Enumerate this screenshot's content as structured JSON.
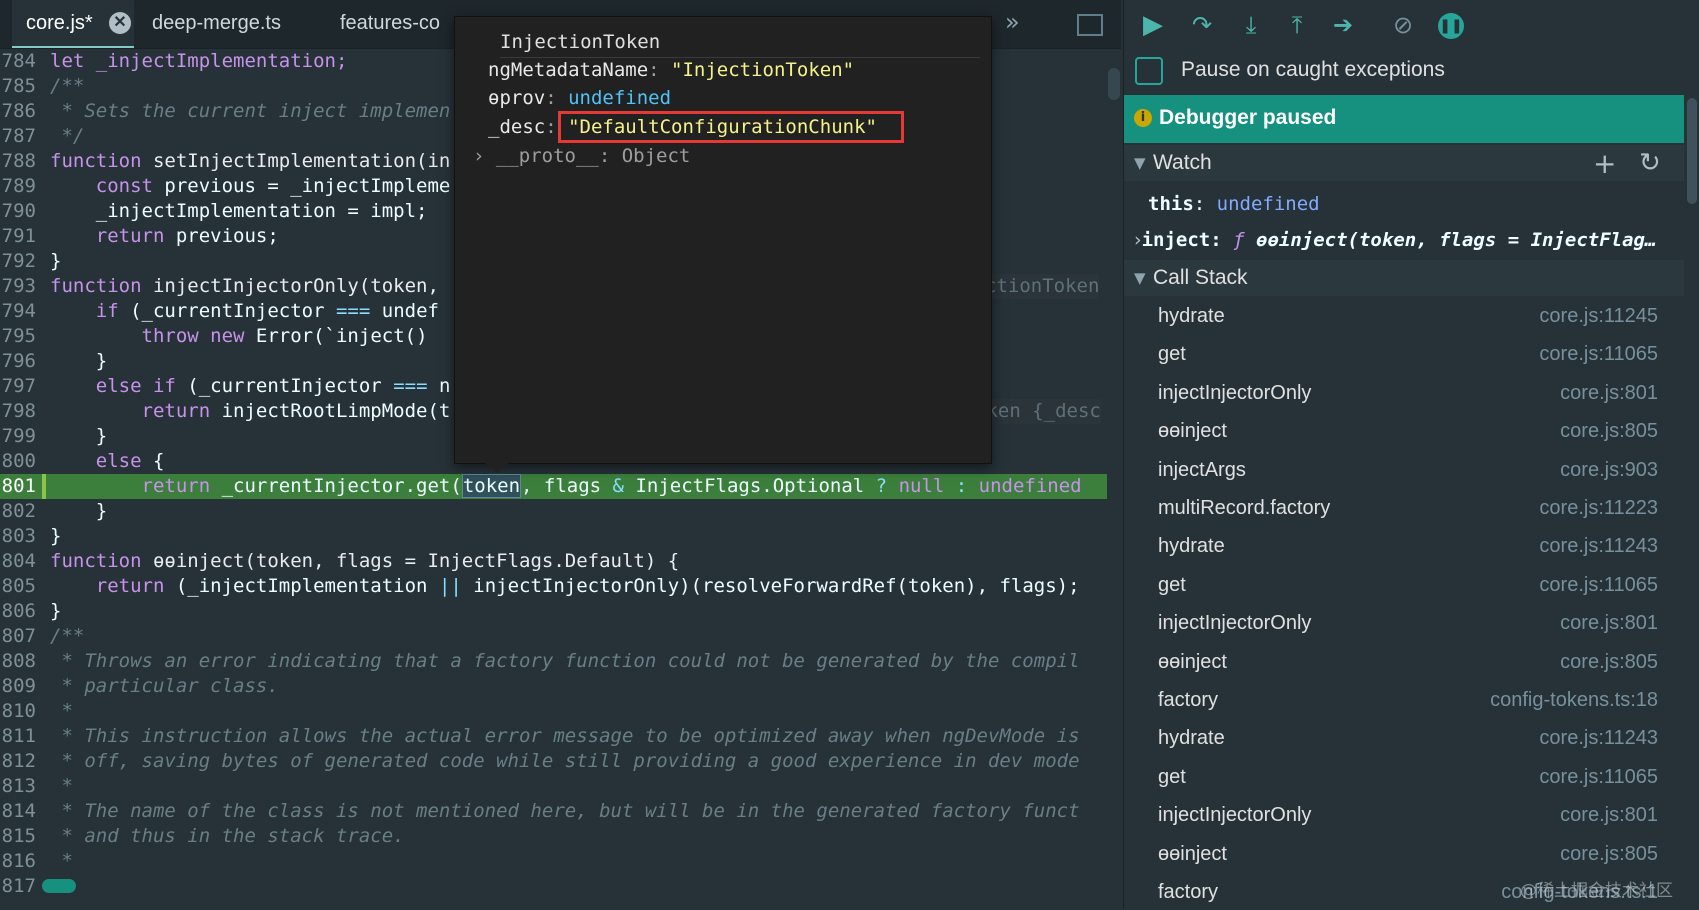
{
  "tabs": [
    {
      "label": "core.js*",
      "active": true
    },
    {
      "label": "deep-merge.ts",
      "active": false
    },
    {
      "label": "features-co",
      "active": false
    }
  ],
  "toolbar": {
    "more_icon": "chevrons-right-icon",
    "panel_icon": "toggle-panel-icon"
  },
  "code_lines": [
    {
      "n": "784"
    },
    {
      "n": "785"
    },
    {
      "n": "786"
    },
    {
      "n": "787"
    },
    {
      "n": "788"
    },
    {
      "n": "789"
    },
    {
      "n": "790"
    },
    {
      "n": "791"
    },
    {
      "n": "792"
    },
    {
      "n": "793"
    },
    {
      "n": "794"
    },
    {
      "n": "795"
    },
    {
      "n": "796"
    },
    {
      "n": "797"
    },
    {
      "n": "798"
    },
    {
      "n": "799"
    },
    {
      "n": "800"
    },
    {
      "n": "801"
    },
    {
      "n": "802"
    },
    {
      "n": "803"
    },
    {
      "n": "804"
    },
    {
      "n": "805"
    },
    {
      "n": "806"
    },
    {
      "n": "807"
    },
    {
      "n": "808"
    },
    {
      "n": "809"
    },
    {
      "n": "810"
    },
    {
      "n": "811"
    },
    {
      "n": "812"
    },
    {
      "n": "813"
    },
    {
      "n": "814"
    },
    {
      "n": "815"
    },
    {
      "n": "816"
    },
    {
      "n": "817"
    }
  ],
  "code": {
    "l784": "let _injectImplementation;",
    "l785": "/**",
    "l786": " * Sets the current inject implemen",
    "l787": " */",
    "l788a": "function",
    "l788b": " setInjectImplementation(in",
    "l789a": "    const",
    "l789b": " previous = _injectImpleme",
    "l790": "    _injectImplementation = impl;",
    "l791a": "    return",
    "l791b": " previous;",
    "l792": "}",
    "l793a": "function",
    "l793b": " injectInjectorOnly(token,",
    "l793ghost": "ctionToken",
    "l794a": "    if",
    "l794b": " (_currentInjector ",
    "l794c": "===",
    "l794d": " undef",
    "l795a": "        throw",
    "l795b": " new",
    "l795c": " Error(`inject() ",
    "l796": "    }",
    "l797a": "    else if",
    "l797b": " (_currentInjector ",
    "l797c": "===",
    "l797d": " n",
    "l798a": "        return",
    "l798b": " injectRootLimpMode(t",
    "l798ghost": "oken {_desc",
    "l799": "    }",
    "l800a": "    else",
    "l800b": " {",
    "l801a": "        return",
    "l801b": " _currentInjector.get(",
    "l801tok": "token",
    "l801c": ", flags ",
    "l801d": "&",
    "l801e": " InjectFlags.Optional ",
    "l801f": "?",
    "l801g": " null ",
    "l801h": ":",
    "l801i": " undefined",
    "l802": "    }",
    "l803": "}",
    "l804a": "function",
    "l804b": " ɵɵinject(token, flags = InjectFlags.Default) {",
    "l805a": "    return",
    "l805b": " (_injectImplementation ",
    "l805c": "||",
    "l805d": " injectInjectorOnly)(resolveForwardRef(token), flags);",
    "l806": "}",
    "l807": "/**",
    "l808": " * Throws an error indicating that a factory function could not be generated by the compil",
    "l809": " * particular class.",
    "l810": " *",
    "l811": " * This instruction allows the actual error message to be optimized away when ngDevMode is",
    "l812": " * off, saving bytes of generated code while still providing a good experience in dev mode",
    "l813": " *",
    "l814": " * The name of the class is not mentioned here, but will be in the generated factory funct",
    "l815": " * and thus in the stack trace.",
    "l816": " *",
    "l817": ""
  },
  "tooltip": {
    "title": "InjectionToken",
    "props": [
      {
        "key": "ngMetadataName",
        "sep": ": ",
        "value": "\"InjectionToken\""
      },
      {
        "key": "ɵprov",
        "sep": ": ",
        "value": "undefined"
      },
      {
        "key": "_desc",
        "sep": ": ",
        "value": "\"DefaultConfigurationChunk\""
      },
      {
        "key": "__proto__",
        "sep": ": ",
        "value": "Object"
      }
    ],
    "highlight_color": "#e53935"
  },
  "debugger": {
    "buttons": [
      {
        "name": "resume-icon"
      },
      {
        "name": "step-over-icon"
      },
      {
        "name": "step-into-icon"
      },
      {
        "name": "step-out-icon"
      },
      {
        "name": "step-icon"
      },
      {
        "name": "deactivate-breakpoints-icon"
      },
      {
        "name": "pause-on-exceptions-icon"
      }
    ],
    "pause_caught_label": "Pause on caught exceptions",
    "paused_text": "Debugger paused",
    "watch": {
      "title": "Watch",
      "items": [
        {
          "key": "this",
          "sep": ": ",
          "value": "undefined"
        },
        {
          "key": "inject",
          "sep": ": ",
          "f": "ƒ",
          "value": "ɵɵinject(token, flags = InjectFlag…"
        }
      ]
    },
    "call_stack": {
      "title": "Call Stack",
      "frames": [
        {
          "name": "hydrate",
          "loc": "core.js:11245"
        },
        {
          "name": "get",
          "loc": "core.js:11065"
        },
        {
          "name": "injectInjectorOnly",
          "loc": "core.js:801"
        },
        {
          "name": "ɵɵinject",
          "loc": "core.js:805"
        },
        {
          "name": "injectArgs",
          "loc": "core.js:903"
        },
        {
          "name": "multiRecord.factory",
          "loc": "core.js:11223"
        },
        {
          "name": "hydrate",
          "loc": "core.js:11243"
        },
        {
          "name": "get",
          "loc": "core.js:11065"
        },
        {
          "name": "injectInjectorOnly",
          "loc": "core.js:801"
        },
        {
          "name": "ɵɵinject",
          "loc": "core.js:805"
        },
        {
          "name": "factory",
          "loc": "config-tokens.ts:18"
        },
        {
          "name": "hydrate",
          "loc": "core.js:11243"
        },
        {
          "name": "get",
          "loc": "core.js:11065"
        },
        {
          "name": "injectInjectorOnly",
          "loc": "core.js:801"
        },
        {
          "name": "ɵɵinject",
          "loc": "core.js:805"
        },
        {
          "name": "factory",
          "loc": "config-tokens.ts:1"
        }
      ]
    }
  },
  "watermark": "@稀土掘金技术社区",
  "colors": {
    "accent": "#16907f",
    "exec_line": "#3c7f3c",
    "keyword": "#c792ea",
    "string": "#c3e88d"
  }
}
